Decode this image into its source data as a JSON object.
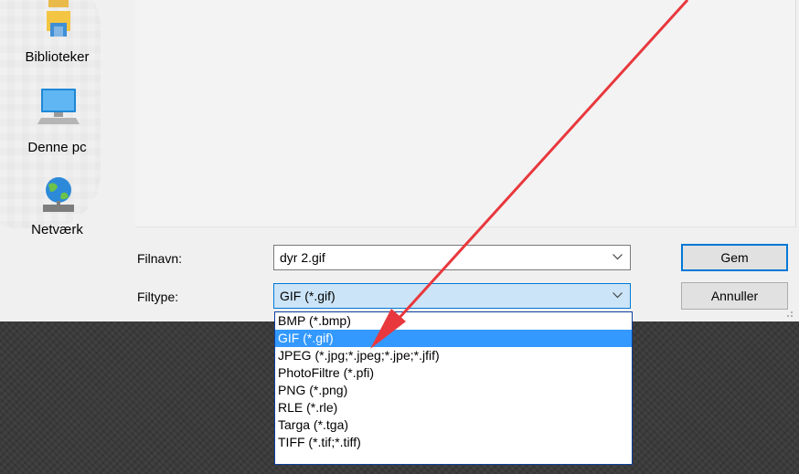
{
  "places": [
    {
      "label": "Biblioteker",
      "icon": "libraries-icon"
    },
    {
      "label": "Denne pc",
      "icon": "this-pc-icon"
    },
    {
      "label": "Netværk",
      "icon": "network-icon"
    }
  ],
  "filename": {
    "label": "Filnavn:",
    "value": "dyr 2.gif"
  },
  "filetype": {
    "label": "Filtype:",
    "value": "GIF (*.gif)"
  },
  "buttons": {
    "save": "Gem",
    "cancel": "Annuller"
  },
  "dropdown": {
    "options": [
      "BMP (*.bmp)",
      "GIF (*.gif)",
      "JPEG (*.jpg;*.jpeg;*.jpe;*.jfif)",
      "PhotoFiltre (*.pfi)",
      "PNG (*.png)",
      "RLE (*.rle)",
      "Targa (*.tga)",
      "TIFF (*.tif;*.tiff)"
    ],
    "selected_index": 1
  },
  "annotation": {
    "color": "#e8383d"
  },
  "colors": {
    "accent": "#0078d7",
    "selection": "#3399ff",
    "field_highlight": "#cce4f7"
  }
}
